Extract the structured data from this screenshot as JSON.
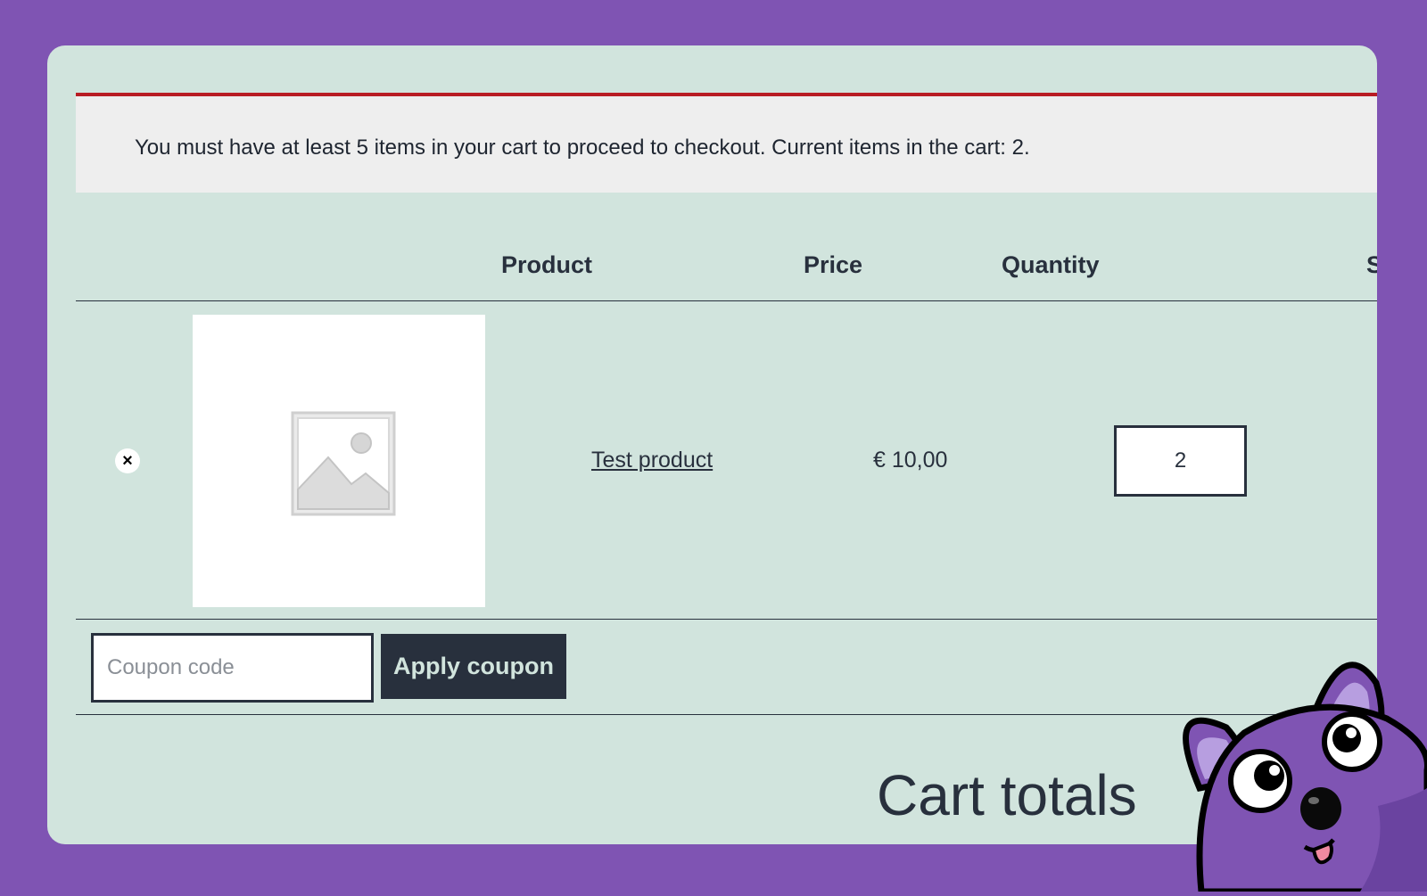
{
  "notice": {
    "message": "You must have at least 5 items in your cart to proceed to checkout. Current items in the cart: 2."
  },
  "table": {
    "headers": [
      "Product",
      "Price",
      "Quantity",
      "S"
    ]
  },
  "cart_item": {
    "remove_icon": "×",
    "thumbnail_icon": "image-placeholder-icon",
    "product_name": "Test product",
    "price": "€ 10,00",
    "quantity": "2"
  },
  "coupon": {
    "placeholder": "Coupon code",
    "value": "",
    "apply_label": "Apply coupon"
  },
  "totals": {
    "heading": "Cart totals"
  },
  "colors": {
    "background": "#7f54b3",
    "panel": "#d1e4dd",
    "notice_border": "#b81c23",
    "button": "#28303d"
  }
}
